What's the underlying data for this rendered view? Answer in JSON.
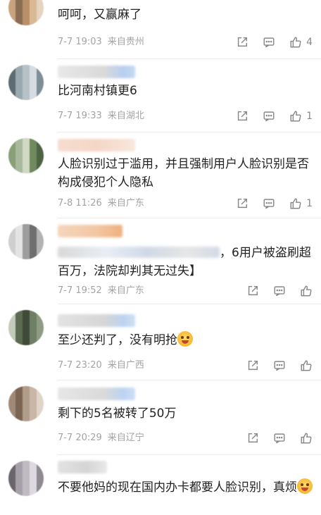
{
  "comments": [
    {
      "text": "呵呵，又赢麻了",
      "date": "7-7 19:03",
      "location": "来自贵州",
      "likes": "4",
      "avatar_colors": [
        "#c9a37d",
        "#d9b896",
        "#8a6e54",
        "#e6d3c0",
        "#b78f6a"
      ]
    },
    {
      "text": "比河南村镇更6",
      "date": "7-7 19:33",
      "location": "来自湖北",
      "likes": "1",
      "avatar_colors": [
        "#7f8e96",
        "#b7c2c8",
        "#5d6b72",
        "#d5dde2",
        "#9aa8af"
      ]
    },
    {
      "text": "人脸识别过于滥用，并且强制用户人脸识别是否构成侵犯个人隐私",
      "date": "7-8 11:26",
      "location": "来自广东",
      "likes": "1",
      "avatar_colors": [
        "#6f8a5e",
        "#a9b99d",
        "#4e6343",
        "#cfd9c4",
        "#889f78"
      ]
    },
    {
      "text_suffix": "，6用户被盗刷超百万，法院却判其无过失】",
      "date": "7-7 19:52",
      "location": "来自广东",
      "likes": "",
      "avatar_colors": [
        "#9d9d9d",
        "#cfcfcf",
        "#6e6e6e",
        "#e4e4e4",
        "#b3b3b3"
      ]
    },
    {
      "text": "至少还判了，没有明抢",
      "date": "7-7 23:20",
      "location": "来自广西",
      "likes": "",
      "avatar_colors": [
        "#5a6b52",
        "#8e9c84",
        "#3f4b38",
        "#c2cbb9",
        "#6f7f66"
      ]
    },
    {
      "text": "剩下的5名被转了50万",
      "date": "7-7 20:29",
      "location": "来自辽宁",
      "likes": "",
      "avatar_colors": [
        "#a08a77",
        "#c9b6a5",
        "#7c6553",
        "#e1d4c7",
        "#b19c89"
      ]
    },
    {
      "text": "不要他妈的现在国内办卡都要人脸识别，真烦",
      "avatar_colors": [
        "#8f8a92",
        "#c0bbc3",
        "#6a656d",
        "#ddd9e0",
        "#a6a1a9"
      ]
    }
  ],
  "icons": {
    "share": "share-icon",
    "comment": "comment-icon",
    "like": "thumbs-up-icon",
    "emoji": "grin-emoji-icon"
  },
  "colors": {
    "meta_text": "#a3a3a3",
    "icon": "#888888",
    "text": "#222222"
  }
}
